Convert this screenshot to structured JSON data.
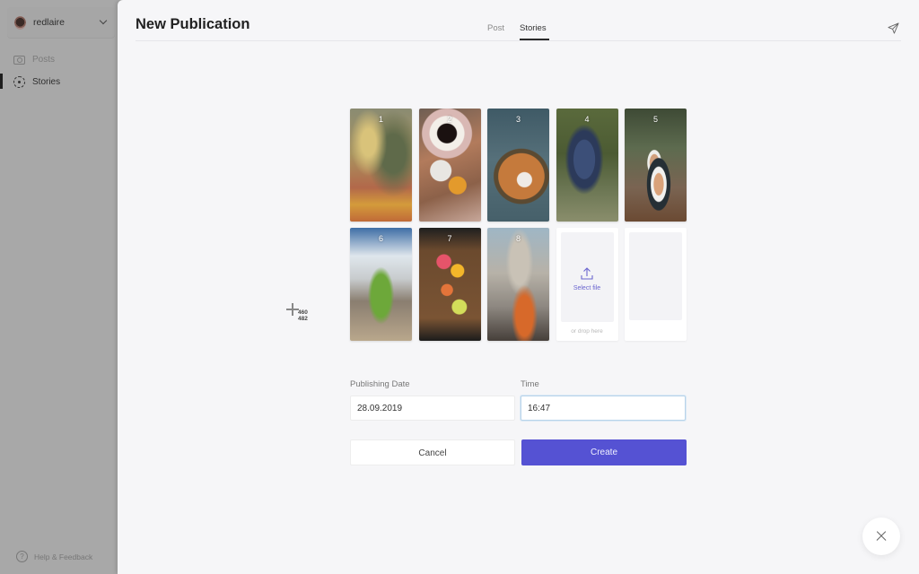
{
  "sidebar": {
    "account_name": "redlaire",
    "items": [
      {
        "label": "Posts",
        "icon": "camera-icon",
        "active": false
      },
      {
        "label": "Stories",
        "icon": "stories-icon",
        "active": true
      }
    ],
    "help_label": "Help & Feedback"
  },
  "header": {
    "title": "New Publication",
    "tabs": [
      {
        "label": "Post",
        "active": false
      },
      {
        "label": "Stories",
        "active": true
      }
    ],
    "send_icon": "send-icon"
  },
  "stories": {
    "tiles": [
      {
        "number": "1",
        "subject": "autumn leaves"
      },
      {
        "number": "2",
        "subject": "coffee and pumpkins"
      },
      {
        "number": "3",
        "subject": "cookies plate"
      },
      {
        "number": "4",
        "subject": "grapes"
      },
      {
        "number": "5",
        "subject": "cappuccino cups"
      },
      {
        "number": "6",
        "subject": "tree and building"
      },
      {
        "number": "7",
        "subject": "citrus slices"
      },
      {
        "number": "8",
        "subject": "cathedral dome"
      }
    ],
    "upload": {
      "select_label": "Select file",
      "drop_label": "or drop here"
    }
  },
  "cursor_readout": {
    "x": "460",
    "y": "482"
  },
  "form": {
    "date_label": "Publishing Date",
    "date_value": "28.09.2019",
    "time_label": "Time",
    "time_value": "16:47"
  },
  "actions": {
    "cancel_label": "Cancel",
    "create_label": "Create",
    "accent_color": "#5552d3"
  }
}
